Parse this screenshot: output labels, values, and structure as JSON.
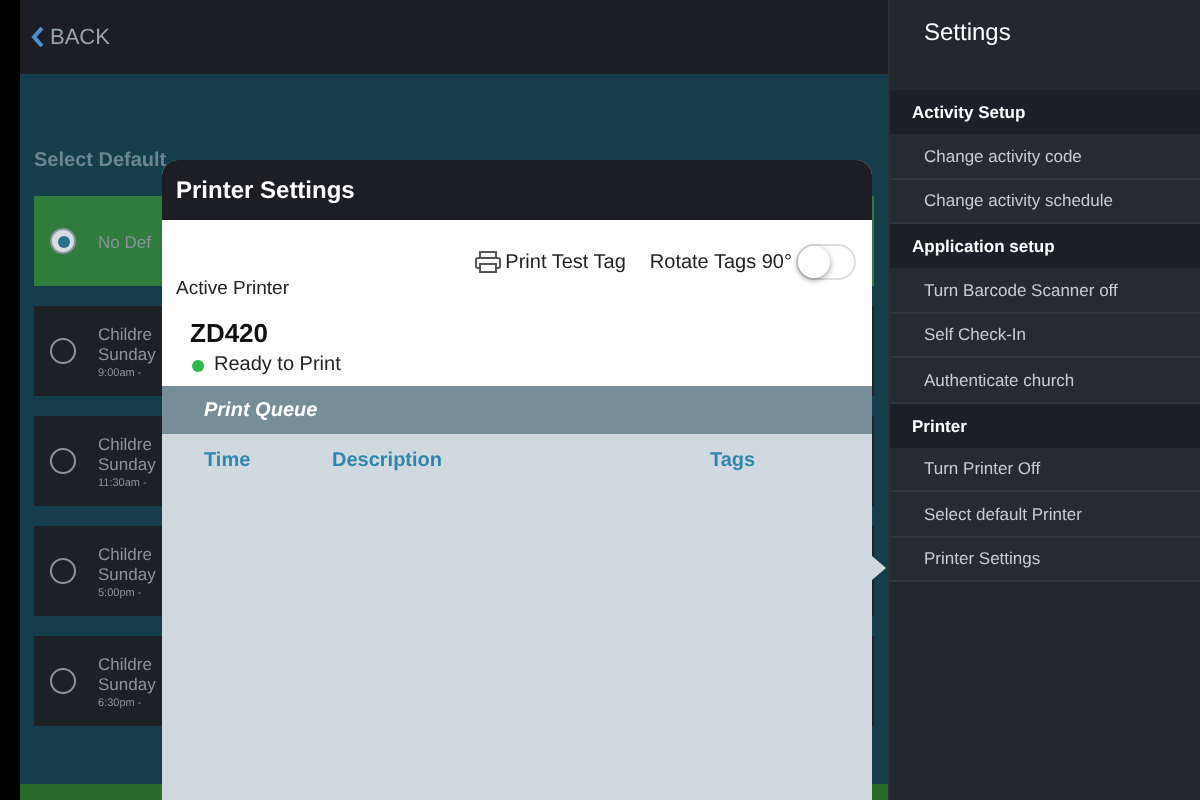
{
  "top_bar": {
    "back": "BACK"
  },
  "schedule": {
    "heading": "Select Default",
    "options": [
      {
        "title": "No Def",
        "selected": true
      },
      {
        "title": "Childre",
        "day": "Sunday",
        "time": "9:00am -",
        "selected": false
      },
      {
        "title": "Childre",
        "day": "Sunday",
        "time": "11:30am -",
        "selected": false
      },
      {
        "title": "Childre",
        "day": "Sunday",
        "time": "5:00pm -",
        "selected": false
      },
      {
        "title": "Childre",
        "day": "Sunday",
        "time": "6:30pm -",
        "selected": false
      }
    ]
  },
  "popover": {
    "title": "Printer Settings",
    "print_test": "Print Test Tag",
    "rotate_label": "Rotate Tags 90°",
    "rotate_on": false,
    "active_label": "Active Printer",
    "printer": "ZD420",
    "status": "Ready to Print",
    "queue_title": "Print Queue",
    "columns": [
      "Time",
      "Description",
      "Tags"
    ]
  },
  "sidebar": {
    "title": "Settings",
    "sections": [
      {
        "heading": "Activity Setup",
        "items": [
          {
            "label": "Change activity code"
          },
          {
            "label": "Change activity schedule"
          }
        ]
      },
      {
        "heading": "Application setup",
        "items": [
          {
            "label": "Turn Barcode Scanner off"
          },
          {
            "label": "Self Check-In"
          },
          {
            "label": "Authenticate church"
          }
        ]
      },
      {
        "heading": "Printer",
        "items": [
          {
            "label": "Turn Printer Off"
          },
          {
            "label": "Select default Printer"
          },
          {
            "label": "Printer Settings"
          }
        ]
      }
    ]
  }
}
